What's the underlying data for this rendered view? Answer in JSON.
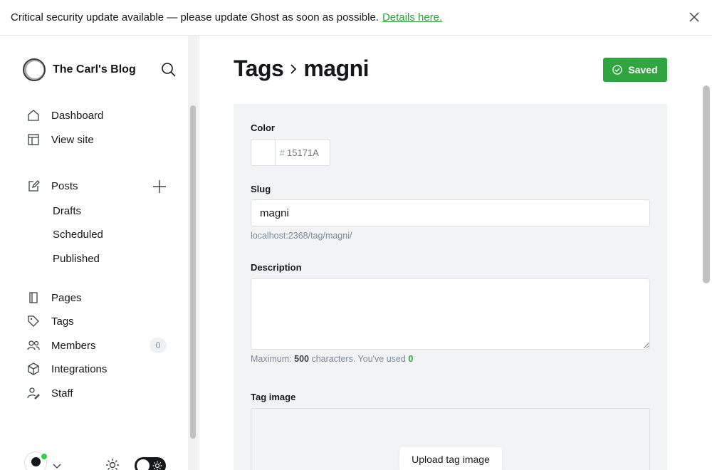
{
  "banner": {
    "message": "Critical security update available — please update Ghost as soon as possible.",
    "link_text": "Details here."
  },
  "sidebar": {
    "site_title": "The Carl's Blog",
    "nav_top": [
      {
        "label": "Dashboard",
        "icon": "home-icon"
      },
      {
        "label": "View site",
        "icon": "view-site-icon"
      }
    ],
    "posts": {
      "label": "Posts",
      "icon": "edit-post-icon"
    },
    "posts_sub": [
      "Drafts",
      "Scheduled",
      "Published"
    ],
    "nav_bottom": [
      {
        "label": "Pages",
        "icon": "pages-icon"
      },
      {
        "label": "Tags",
        "icon": "tag-icon"
      },
      {
        "label": "Members",
        "icon": "members-icon",
        "count": "0"
      },
      {
        "label": "Integrations",
        "icon": "integrations-icon"
      },
      {
        "label": "Staff",
        "icon": "staff-icon"
      }
    ]
  },
  "header": {
    "parent": "Tags",
    "current": "magni",
    "saved_label": "Saved"
  },
  "form": {
    "color_label": "Color",
    "color_hash": "#",
    "color_placeholder": "15171A",
    "slug_label": "Slug",
    "slug_value": "magni",
    "slug_url": "localhost:2368/tag/magni/",
    "description_label": "Description",
    "description_value": "",
    "desc_hint_prefix": "Maximum:",
    "desc_max": "500",
    "desc_hint_mid": "characters. You've used",
    "desc_used": "0",
    "tag_image_label": "Tag image",
    "upload_label": "Upload tag image"
  },
  "colors": {
    "accent_green": "#30a43f",
    "link_green": "#2ea13a",
    "status_dot": "#30cf43"
  }
}
